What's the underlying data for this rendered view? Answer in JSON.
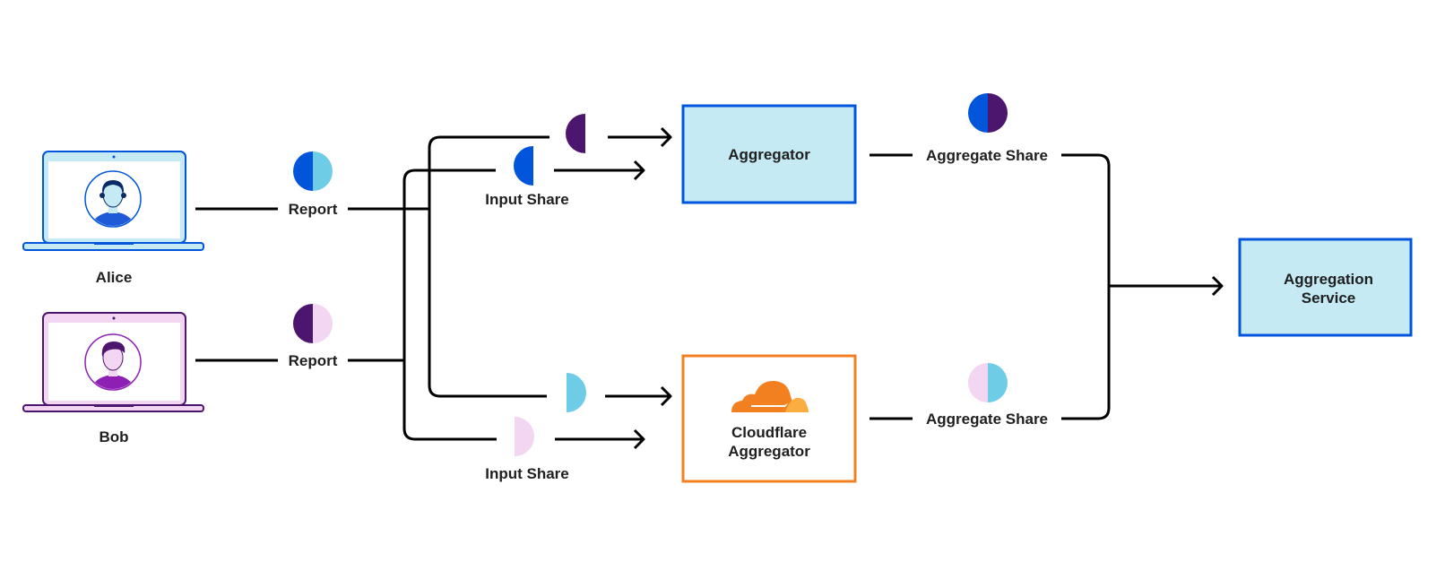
{
  "users": [
    {
      "name": "Alice"
    },
    {
      "name": "Bob"
    }
  ],
  "report_label": "Report",
  "input_share_label": "Input Share",
  "aggregators": [
    {
      "label": "Aggregator"
    },
    {
      "label_line1": "Cloudflare",
      "label_line2": "Aggregator"
    }
  ],
  "aggregate_share_label": "Aggregate Share",
  "service": {
    "line1": "Aggregation",
    "line2": "Service"
  },
  "colors": {
    "blue": "#0055DB",
    "cyan": "#6ECCE6",
    "purple": "#4D166E",
    "pink": "#F2D6F2",
    "box_fill": "#C5EAF4",
    "orange": "#F38020",
    "orange_light": "#FBAD41"
  }
}
